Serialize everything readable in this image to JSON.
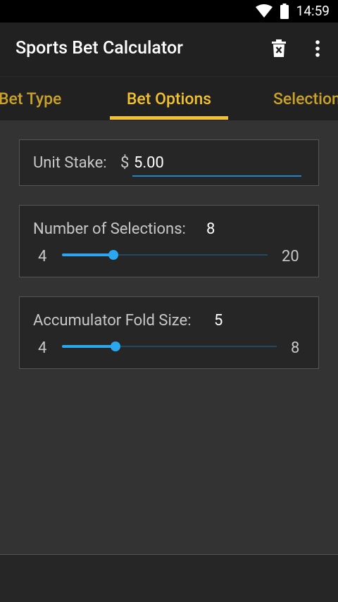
{
  "status_bar": {
    "time": "14:59",
    "icons": [
      "wifi-icon",
      "battery-icon"
    ]
  },
  "app_bar": {
    "title": "Sports Bet Calculator",
    "actions": [
      "delete-icon",
      "more-vert-icon"
    ]
  },
  "tabs": [
    {
      "label": "Bet Type",
      "selected": false
    },
    {
      "label": "Bet Options",
      "selected": true
    },
    {
      "label": "Selections",
      "selected": false
    }
  ],
  "stake": {
    "label": "Unit Stake:",
    "currency": "$",
    "value": "5.00"
  },
  "selections": {
    "label": "Number of Selections:",
    "value": "8",
    "min": "4",
    "max": "20",
    "level": 0.25
  },
  "fold": {
    "label": "Accumulator Fold Size:",
    "value": "5",
    "min": "4",
    "max": "8",
    "level": 0.25
  },
  "colors": {
    "accent": "#f2c12e",
    "slider": "#29a8f0",
    "background": "#333333",
    "bar": "#212121"
  }
}
